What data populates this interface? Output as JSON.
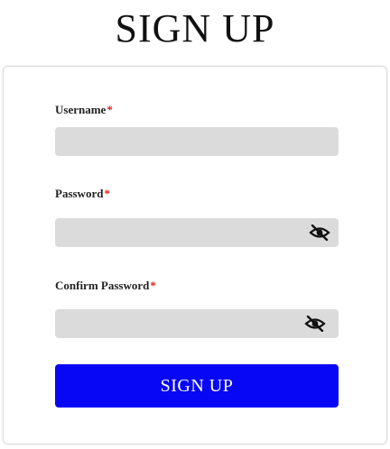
{
  "page": {
    "title": "SIGN UP"
  },
  "form": {
    "required_marker": "*",
    "fields": [
      {
        "label": "Username",
        "value": "",
        "placeholder": "",
        "type": "text",
        "has_visibility_toggle": false
      },
      {
        "label": "Password",
        "value": "",
        "placeholder": "",
        "type": "password",
        "has_visibility_toggle": true,
        "toggle_icon": "eye-off-icon"
      },
      {
        "label": "Confirm Password",
        "value": "",
        "placeholder": "",
        "type": "password",
        "has_visibility_toggle": true,
        "toggle_icon": "eye-off-icon"
      }
    ],
    "submit_label": "SIGN UP"
  },
  "colors": {
    "primary_button": "#0707f5",
    "required_marker": "#e21a1a",
    "input_background": "#dbdbdb"
  }
}
